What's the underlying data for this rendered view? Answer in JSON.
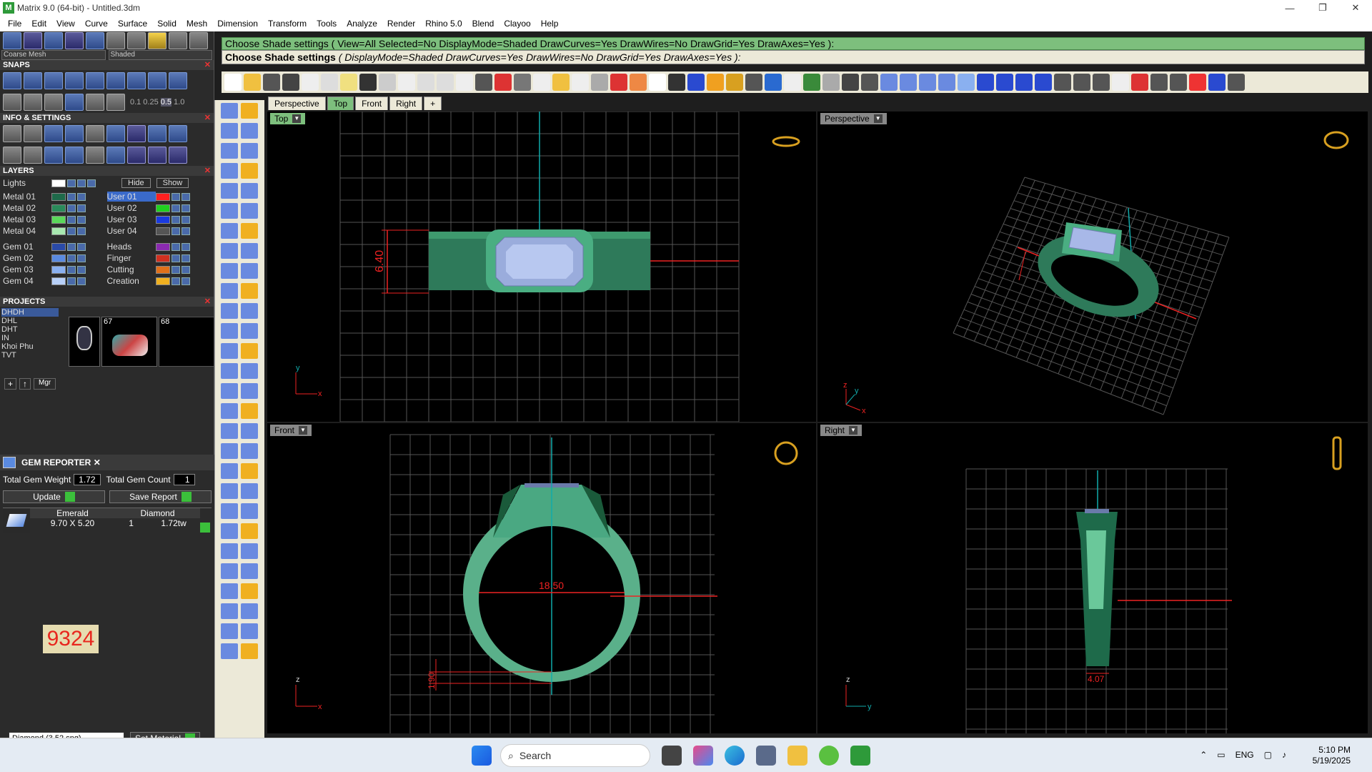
{
  "window": {
    "title": "Matrix 9.0 (64-bit) - Untitled.3dm",
    "controls": {
      "minimize": "—",
      "restore": "❐",
      "close": "✕"
    }
  },
  "menu": [
    "File",
    "Edit",
    "View",
    "Curve",
    "Surface",
    "Solid",
    "Mesh",
    "Dimension",
    "Transform",
    "Tools",
    "Analyze",
    "Render",
    "Rhino 5.0",
    "Blend",
    "Clayoo",
    "Help"
  ],
  "display": {
    "mesh_dropdown": "Coarse Mesh",
    "mode_dropdown": "Shaded"
  },
  "snaps": {
    "title": "SNAPS",
    "values": [
      "0.1",
      "0.25",
      "0.5",
      "1.0"
    ]
  },
  "info": {
    "title": "INFO & SETTINGS"
  },
  "layers": {
    "title": "LAYERS",
    "lights": "Lights",
    "hide": "Hide",
    "show": "Show",
    "left": [
      {
        "name": "Metal 01",
        "color": "#1e6a4a"
      },
      {
        "name": "Metal 02",
        "color": "#2a8a5a"
      },
      {
        "name": "Metal 03",
        "color": "#5ad85a"
      },
      {
        "name": "Metal 04",
        "color": "#a8e8b0"
      },
      {
        "name": "Gem 01",
        "color": "#2a4aa8"
      },
      {
        "name": "Gem 02",
        "color": "#5a8ae0"
      },
      {
        "name": "Gem 03",
        "color": "#8ab0f0"
      },
      {
        "name": "Gem 04",
        "color": "#b8d0f8"
      }
    ],
    "right": [
      {
        "name": "User 01",
        "color": "#ff2020"
      },
      {
        "name": "User 02",
        "color": "#20d020"
      },
      {
        "name": "User 03",
        "color": "#1a3ae0"
      },
      {
        "name": "User 04",
        "color": "#555555"
      },
      {
        "name": "Heads",
        "color": "#8a2ab0"
      },
      {
        "name": "Finger",
        "color": "#d03020"
      },
      {
        "name": "Cutting",
        "color": "#e0701a"
      },
      {
        "name": "Creation",
        "color": "#f0b020"
      }
    ]
  },
  "projects": {
    "title": "PROJECTS",
    "list": [
      "DHDH",
      "DHL",
      "DHT",
      "IN",
      "Khoi Phu",
      "TVT"
    ],
    "thumb_labels": [
      "67",
      "68"
    ],
    "mgr": "Mgr"
  },
  "gem_reporter": {
    "title": "GEM REPORTER",
    "weight_label": "Total Gem Weight",
    "weight": "1.72",
    "count_label": "Total Gem Count",
    "count": "1",
    "update": "Update",
    "save_report": "Save Report",
    "col1": "Emerald",
    "col2": "Diamond",
    "size": "9.70 X 5.20",
    "qty": "1",
    "ctw": "1.72tw"
  },
  "badge": "9324",
  "material": {
    "value": "Diamond     (3.52 spg)",
    "button": "Set Material"
  },
  "command": {
    "line1": "Choose Shade settings ( View=All  Selected=No  DisplayMode=Shaded  DrawCurves=Yes  DrawWires=No  DrawGrid=Yes  DrawAxes=Yes ):",
    "line2_prefix": "Choose Shade settings",
    "line2_args": "( DisplayMode=Shaded  DrawCurves=Yes  DrawWires=No  DrawGrid=Yes  DrawAxes=Yes ):"
  },
  "viewport_tabs": [
    "Perspective",
    "Top",
    "Front",
    "Right",
    "+"
  ],
  "viewports": {
    "top": {
      "label": "Top",
      "dim": "6.40"
    },
    "perspective": {
      "label": "Perspective"
    },
    "front": {
      "label": "Front",
      "dim1": "18.50",
      "dim2": "1.90"
    },
    "right": {
      "label": "Right",
      "dim": "4.07"
    }
  },
  "axes": {
    "x": "x",
    "y": "y",
    "z": "z"
  },
  "taskbar": {
    "search": "Search",
    "lang": "ENG",
    "time": "5:10 PM",
    "date": "5/19/2025"
  }
}
